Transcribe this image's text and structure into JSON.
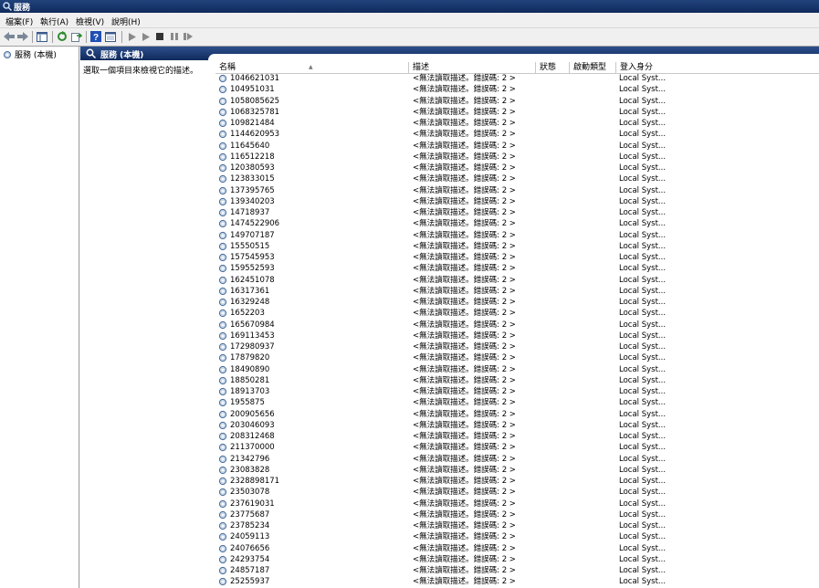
{
  "window": {
    "title": "服務"
  },
  "menu": [
    "檔案(F)",
    "執行(A)",
    "檢視(V)",
    "說明(H)"
  ],
  "toolbar": {
    "icons": [
      "back-arrow-icon",
      "forward-arrow-icon",
      "show-hide-tree-icon",
      "refresh-icon",
      "export-icon",
      "help-icon",
      "properties-icon",
      "start-icon",
      "start-alt-icon",
      "stop-icon",
      "pause-icon",
      "restart-icon"
    ]
  },
  "tree": {
    "root_label": "服務 (本機)"
  },
  "pane": {
    "title": "服務 (本機)",
    "description": "選取一個項目來檢視它的描述。"
  },
  "columns": {
    "name": "名稱",
    "description": "描述",
    "status": "狀態",
    "startup": "啟動類型",
    "logon": "登入身分"
  },
  "services": [
    {
      "name": "1046621031",
      "description": "<無法讀取描述。錯誤碼: 2 >",
      "logon": "Local Syst..."
    },
    {
      "name": "104951031",
      "description": "<無法讀取描述。錯誤碼: 2 >",
      "logon": "Local Syst..."
    },
    {
      "name": "1058085625",
      "description": "<無法讀取描述。錯誤碼: 2 >",
      "logon": "Local Syst..."
    },
    {
      "name": "1068325781",
      "description": "<無法讀取描述。錯誤碼: 2 >",
      "logon": "Local Syst..."
    },
    {
      "name": "109821484",
      "description": "<無法讀取描述。錯誤碼: 2 >",
      "logon": "Local Syst..."
    },
    {
      "name": "1144620953",
      "description": "<無法讀取描述。錯誤碼: 2 >",
      "logon": "Local Syst..."
    },
    {
      "name": "11645640",
      "description": "<無法讀取描述。錯誤碼: 2 >",
      "logon": "Local Syst..."
    },
    {
      "name": "116512218",
      "description": "<無法讀取描述。錯誤碼: 2 >",
      "logon": "Local Syst..."
    },
    {
      "name": "120380593",
      "description": "<無法讀取描述。錯誤碼: 2 >",
      "logon": "Local Syst..."
    },
    {
      "name": "123833015",
      "description": "<無法讀取描述。錯誤碼: 2 >",
      "logon": "Local Syst..."
    },
    {
      "name": "137395765",
      "description": "<無法讀取描述。錯誤碼: 2 >",
      "logon": "Local Syst..."
    },
    {
      "name": "139340203",
      "description": "<無法讀取描述。錯誤碼: 2 >",
      "logon": "Local Syst..."
    },
    {
      "name": "14718937",
      "description": "<無法讀取描述。錯誤碼: 2 >",
      "logon": "Local Syst..."
    },
    {
      "name": "1474522906",
      "description": "<無法讀取描述。錯誤碼: 2 >",
      "logon": "Local Syst..."
    },
    {
      "name": "149707187",
      "description": "<無法讀取描述。錯誤碼: 2 >",
      "logon": "Local Syst..."
    },
    {
      "name": "15550515",
      "description": "<無法讀取描述。錯誤碼: 2 >",
      "logon": "Local Syst..."
    },
    {
      "name": "157545953",
      "description": "<無法讀取描述。錯誤碼: 2 >",
      "logon": "Local Syst..."
    },
    {
      "name": "159552593",
      "description": "<無法讀取描述。錯誤碼: 2 >",
      "logon": "Local Syst..."
    },
    {
      "name": "162451078",
      "description": "<無法讀取描述。錯誤碼: 2 >",
      "logon": "Local Syst..."
    },
    {
      "name": "16317361",
      "description": "<無法讀取描述。錯誤碼: 2 >",
      "logon": "Local Syst..."
    },
    {
      "name": "16329248",
      "description": "<無法讀取描述。錯誤碼: 2 >",
      "logon": "Local Syst..."
    },
    {
      "name": "1652203",
      "description": "<無法讀取描述。錯誤碼: 2 >",
      "logon": "Local Syst..."
    },
    {
      "name": "165670984",
      "description": "<無法讀取描述。錯誤碼: 2 >",
      "logon": "Local Syst..."
    },
    {
      "name": "169113453",
      "description": "<無法讀取描述。錯誤碼: 2 >",
      "logon": "Local Syst..."
    },
    {
      "name": "172980937",
      "description": "<無法讀取描述。錯誤碼: 2 >",
      "logon": "Local Syst..."
    },
    {
      "name": "17879820",
      "description": "<無法讀取描述。錯誤碼: 2 >",
      "logon": "Local Syst..."
    },
    {
      "name": "18490890",
      "description": "<無法讀取描述。錯誤碼: 2 >",
      "logon": "Local Syst..."
    },
    {
      "name": "18850281",
      "description": "<無法讀取描述。錯誤碼: 2 >",
      "logon": "Local Syst..."
    },
    {
      "name": "18913703",
      "description": "<無法讀取描述。錯誤碼: 2 >",
      "logon": "Local Syst..."
    },
    {
      "name": "1955875",
      "description": "<無法讀取描述。錯誤碼: 2 >",
      "logon": "Local Syst..."
    },
    {
      "name": "200905656",
      "description": "<無法讀取描述。錯誤碼: 2 >",
      "logon": "Local Syst..."
    },
    {
      "name": "203046093",
      "description": "<無法讀取描述。錯誤碼: 2 >",
      "logon": "Local Syst..."
    },
    {
      "name": "208312468",
      "description": "<無法讀取描述。錯誤碼: 2 >",
      "logon": "Local Syst..."
    },
    {
      "name": "211370000",
      "description": "<無法讀取描述。錯誤碼: 2 >",
      "logon": "Local Syst..."
    },
    {
      "name": "21342796",
      "description": "<無法讀取描述。錯誤碼: 2 >",
      "logon": "Local Syst..."
    },
    {
      "name": "23083828",
      "description": "<無法讀取描述。錯誤碼: 2 >",
      "logon": "Local Syst..."
    },
    {
      "name": "2328898171",
      "description": "<無法讀取描述。錯誤碼: 2 >",
      "logon": "Local Syst..."
    },
    {
      "name": "23503078",
      "description": "<無法讀取描述。錯誤碼: 2 >",
      "logon": "Local Syst..."
    },
    {
      "name": "237619031",
      "description": "<無法讀取描述。錯誤碼: 2 >",
      "logon": "Local Syst..."
    },
    {
      "name": "23775687",
      "description": "<無法讀取描述。錯誤碼: 2 >",
      "logon": "Local Syst..."
    },
    {
      "name": "23785234",
      "description": "<無法讀取描述。錯誤碼: 2 >",
      "logon": "Local Syst..."
    },
    {
      "name": "24059113",
      "description": "<無法讀取描述。錯誤碼: 2 >",
      "logon": "Local Syst..."
    },
    {
      "name": "24076656",
      "description": "<無法讀取描述。錯誤碼: 2 >",
      "logon": "Local Syst..."
    },
    {
      "name": "24293754",
      "description": "<無法讀取描述。錯誤碼: 2 >",
      "logon": "Local Syst..."
    },
    {
      "name": "24857187",
      "description": "<無法讀取描述。錯誤碼: 2 >",
      "logon": "Local Syst..."
    },
    {
      "name": "25255937",
      "description": "<無法讀取描述。錯誤碼: 2 >",
      "logon": "Local Syst..."
    }
  ]
}
